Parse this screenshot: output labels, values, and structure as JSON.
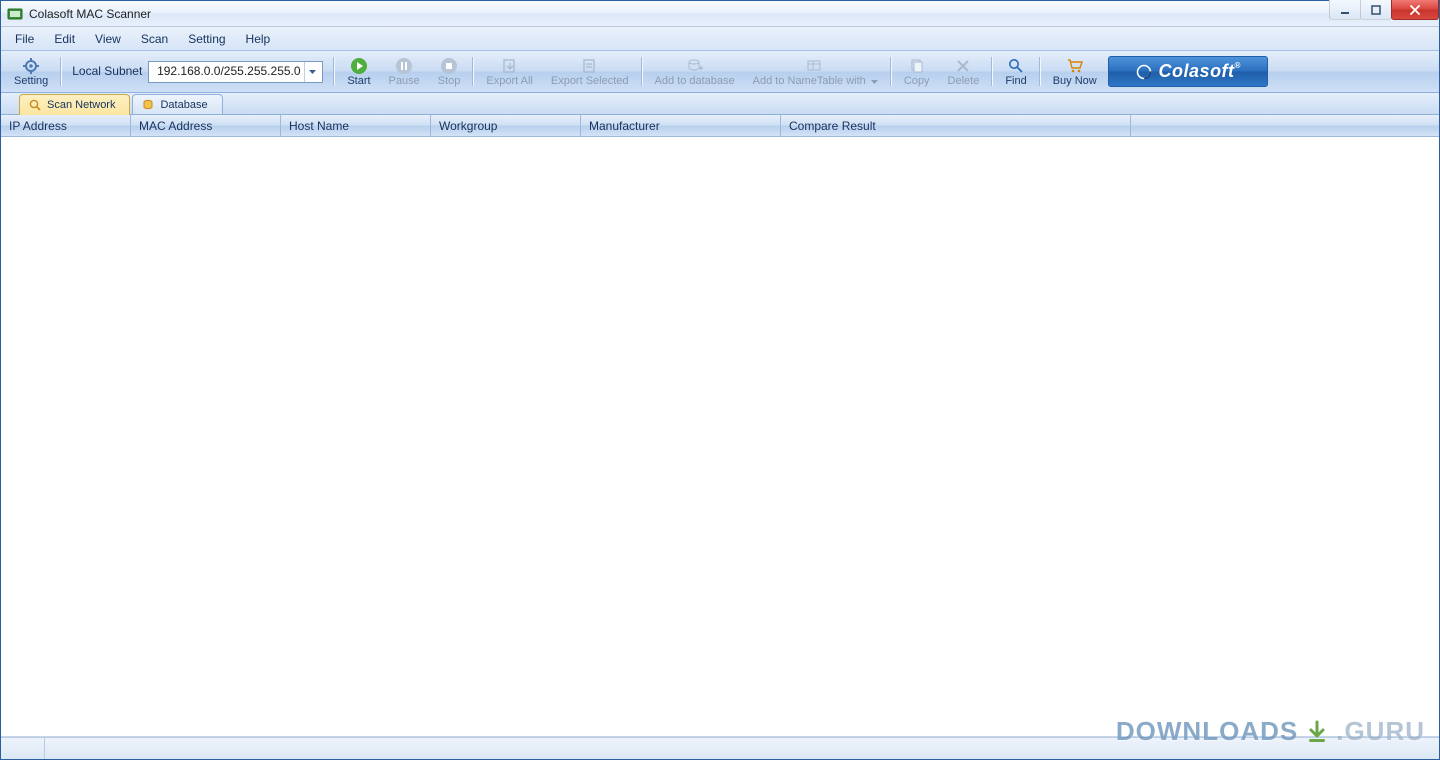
{
  "window": {
    "title": "Colasoft MAC Scanner"
  },
  "menu": {
    "file": "File",
    "edit": "Edit",
    "view": "View",
    "scan": "Scan",
    "setting": "Setting",
    "help": "Help"
  },
  "toolbar": {
    "setting": "Setting",
    "subnet_label": "Local Subnet",
    "subnet_value": "192.168.0.0/255.255.255.0",
    "start": "Start",
    "pause": "Pause",
    "stop": "Stop",
    "export_all": "Export All",
    "export_selected": "Export Selected",
    "add_db": "Add to database",
    "add_nametable": "Add to NameTable with",
    "copy": "Copy",
    "delete": "Delete",
    "find": "Find",
    "buy": "Buy Now",
    "brand": "Colasoft"
  },
  "tabs": {
    "scan": "Scan Network",
    "db": "Database"
  },
  "columns": {
    "ip": "IP Address",
    "mac": "MAC Address",
    "host": "Host Name",
    "wg": "Workgroup",
    "manu": "Manufacturer",
    "cmp": "Compare Result"
  },
  "watermark": {
    "a": "DOWNLOADS",
    "b": ".GURU"
  },
  "col_widths": {
    "ip": 130,
    "mac": 150,
    "host": 150,
    "wg": 150,
    "manu": 200,
    "cmp": 350
  }
}
